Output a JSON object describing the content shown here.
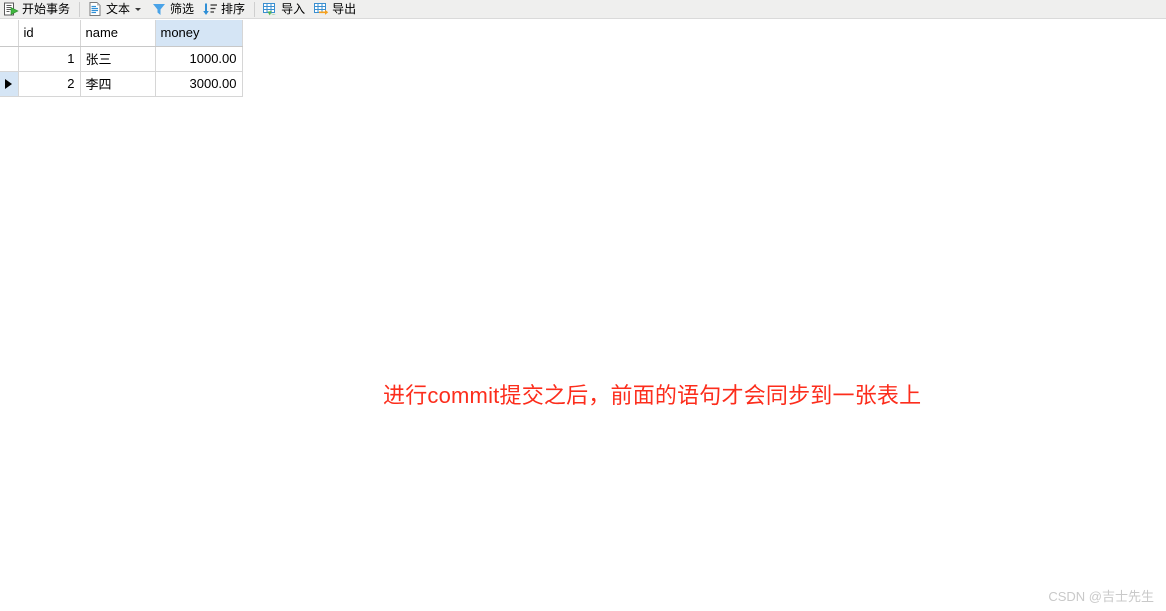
{
  "toolbar": {
    "buttons": [
      {
        "label": "开始事务",
        "icon": "begin-transaction-icon",
        "has_caret": false
      },
      {
        "label": "文本",
        "icon": "text-document-icon",
        "has_caret": true
      },
      {
        "label": "筛选",
        "icon": "filter-funnel-icon",
        "has_caret": false
      },
      {
        "label": "排序",
        "icon": "sort-descending-icon",
        "has_caret": false
      },
      {
        "label": "导入",
        "icon": "import-grid-icon",
        "has_caret": false
      },
      {
        "label": "导出",
        "icon": "export-grid-icon",
        "has_caret": false
      }
    ]
  },
  "grid": {
    "columns": [
      {
        "key": "id",
        "label": "id",
        "selected": false
      },
      {
        "key": "name",
        "label": "name",
        "selected": false
      },
      {
        "key": "money",
        "label": "money",
        "selected": true
      }
    ],
    "rows": [
      {
        "current": false,
        "id": "1",
        "name": "张三",
        "money": "1000.00"
      },
      {
        "current": true,
        "id": "2",
        "name": "李四",
        "money": "3000.00"
      }
    ]
  },
  "annotation": {
    "text": "进行commit提交之后，前面的语句才会同步到一张表上",
    "color": "#fc2d1c"
  },
  "watermark": {
    "text": "CSDN @吉士先生",
    "color": "#c9c9c9"
  },
  "colors": {
    "toolbar_bg": "#efefee",
    "selected_header": "#d5e5f5",
    "grid_line": "#d6d6d6"
  }
}
